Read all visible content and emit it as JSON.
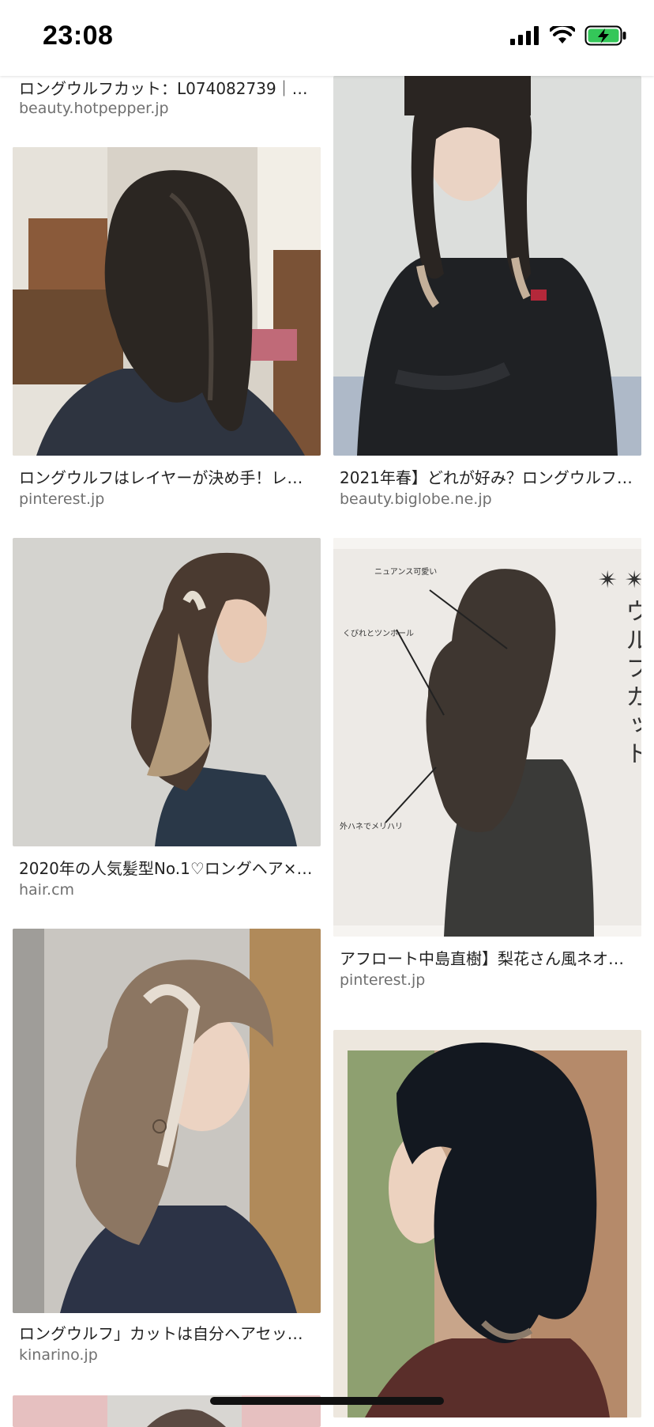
{
  "status_bar": {
    "time": "23:08",
    "signal_icon": "cellular-signal-icon",
    "wifi_icon": "wifi-icon",
    "battery_icon": "battery-charging-icon",
    "battery_color": "#34c759"
  },
  "results": {
    "left": [
      {
        "title": "ロングウルフカット：L074082739｜…",
        "source": "beauty.hotpepper.jp"
      },
      {
        "title": "ロングウルフはレイヤーが決め手！レ…",
        "source": "pinterest.jp"
      },
      {
        "title": "2020年の人気髪型No.1♡ロングヘア×…",
        "source": "hair.cm"
      },
      {
        "title": "ロングウルフ」カットは自分ヘアセッ…",
        "source": "kinarino.jp"
      }
    ],
    "right": [
      {
        "title": "2021年春】どれが好み？ロングウルフ…",
        "source": "beauty.biglobe.ne.jp"
      },
      {
        "title": "アフロート中島直樹】梨花さん風ネオ…",
        "source": "pinterest.jp"
      }
    ]
  },
  "image_annotations": {
    "vertical_title": "✴ロングヘアの✴ウルフカット✴",
    "labels": [
      "ニュアンス可愛い",
      "くびれとツンホール",
      "外ハネでメリハリ"
    ]
  }
}
